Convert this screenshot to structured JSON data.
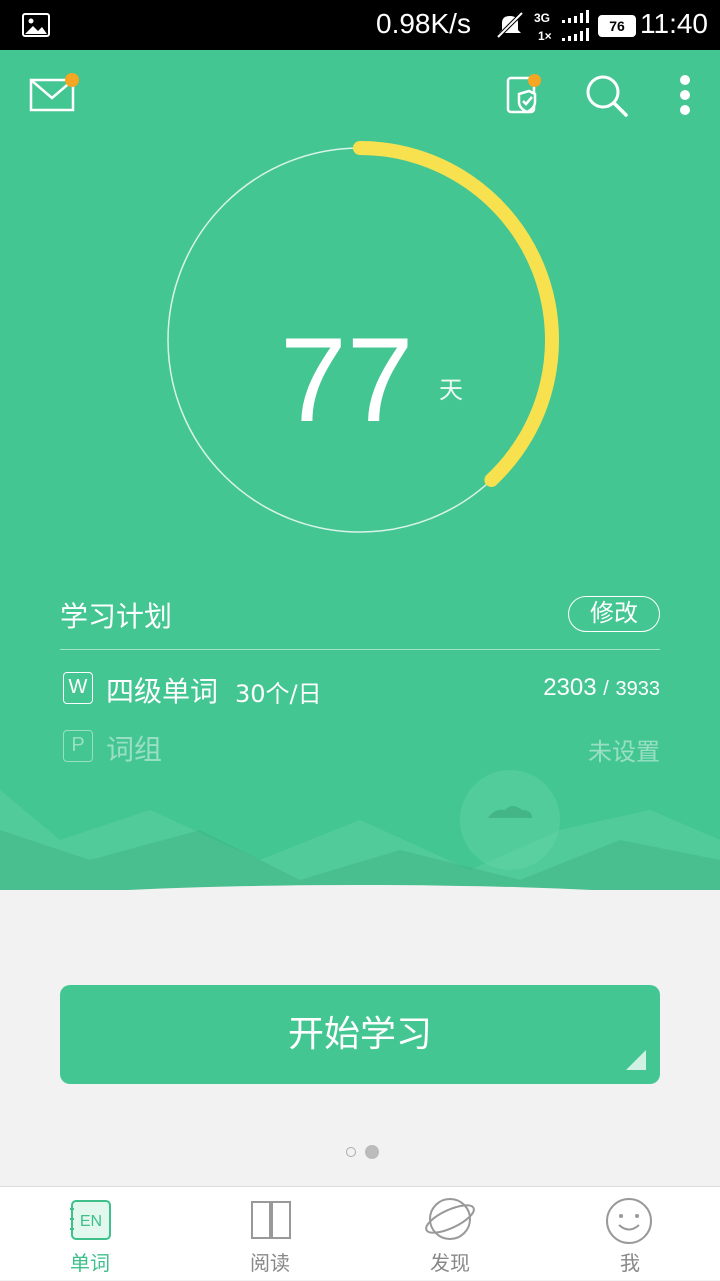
{
  "status_bar": {
    "net_speed": "0.98K/s",
    "network_top": "3G",
    "network_bottom": "1×",
    "battery": "76",
    "time": "11:40"
  },
  "header": {
    "icons": [
      "mail-icon",
      "checkin-icon",
      "search-icon",
      "more-icon"
    ]
  },
  "countdown": {
    "days": "77",
    "unit": "天",
    "progress": 0.38
  },
  "plan": {
    "title": "学习计划",
    "edit_label": "修改",
    "words": {
      "badge": "W",
      "name": "四级单词",
      "per_day": "30个/日",
      "done": "2303",
      "separator": "/",
      "total": "3933"
    },
    "phrases": {
      "badge": "P",
      "name": "词组",
      "status": "未设置"
    }
  },
  "start_button": "开始学习",
  "pager": {
    "current": 2,
    "count": 2
  },
  "tabs": [
    {
      "label": "单词",
      "icon_text": "EN",
      "active": true
    },
    {
      "label": "阅读",
      "active": false
    },
    {
      "label": "发现",
      "active": false
    },
    {
      "label": "我",
      "active": false
    }
  ],
  "colors": {
    "primary": "#44c693",
    "accent_yellow": "#f8e14f",
    "badge_orange": "#f5a623",
    "background": "#f2f2f2"
  }
}
